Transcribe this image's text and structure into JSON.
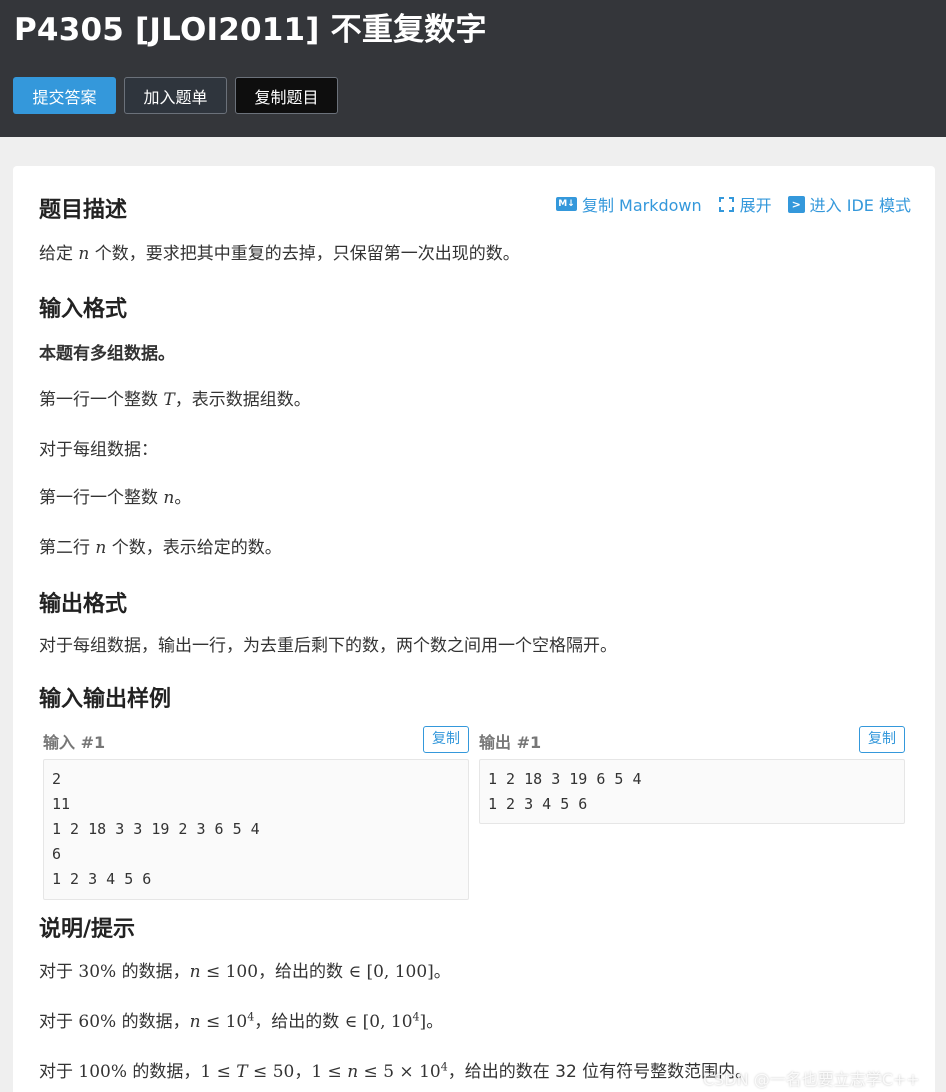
{
  "header": {
    "title": "P4305 [JLOI2011] 不重复数字",
    "buttons": {
      "submit": "提交答案",
      "add_to_list": "加入题单",
      "copy_problem": "复制题目"
    }
  },
  "toolbar": {
    "copy_markdown": "复制 Markdown",
    "expand": "展开",
    "ide_mode": "进入 IDE 模式",
    "md_icon_text": "M↓"
  },
  "description": {
    "heading": "题目描述",
    "text_before": "给定 ",
    "var_n": "n",
    "text_after": " 个数，要求把其中重复的去掉，只保留第一次出现的数。"
  },
  "input_format": {
    "heading": "输入格式",
    "bold_line": "本题有多组数据。",
    "line1_before": "第一行一个整数 ",
    "line1_var": "T",
    "line1_after": "，表示数据组数。",
    "line2": "对于每组数据：",
    "line3_before": "第一行一个整数 ",
    "line3_var": "n",
    "line3_after": "。",
    "line4_before": "第二行 ",
    "line4_var": "n",
    "line4_after": " 个数，表示给定的数。"
  },
  "output_format": {
    "heading": "输出格式",
    "text": "对于每组数据，输出一行，为去重后剩下的数，两个数之间用一个空格隔开。"
  },
  "samples": {
    "heading": "输入输出样例",
    "input_label": "输入 #1",
    "output_label": "输出 #1",
    "copy_label": "复制",
    "input_lines": [
      "2",
      "11",
      "1 2 18 3 3 19 2 3 6 5 4",
      "6",
      "1 2 3 4 5 6"
    ],
    "output_lines": [
      "1 2 18 3 19 6 5 4",
      "1 2 3 4 5 6"
    ]
  },
  "hint": {
    "heading": "说明/提示",
    "l1": {
      "a": "对于 ",
      "pct": "30%",
      "b": " 的数据，",
      "n": "n",
      "le": " ≤ 100",
      "c": "，给出的数 ",
      "range": "∈ [0, 100]",
      "d": "。"
    },
    "l2": {
      "a": "对于 ",
      "pct": "60%",
      "b": " 的数据，",
      "n": "n",
      "le": " ≤ 10",
      "exp": "4",
      "c": "，给出的数 ",
      "range": "∈ [0, 10",
      "range_exp": "4",
      "range_end": "]",
      "d": "。"
    },
    "l3": {
      "a": "对于 ",
      "pct": "100%",
      "b": " 的数据，",
      "t1": "1 ≤ ",
      "T": "T",
      "t2": " ≤ 50",
      "sep": "，",
      "n1": "1 ≤ ",
      "n": "n",
      "n2": " ≤ 5 × 10",
      "exp": "4",
      "c": "，给出的数在 32 位有符号整数范围内。"
    }
  },
  "watermark": "CSDN @一名也要立志学C++"
}
